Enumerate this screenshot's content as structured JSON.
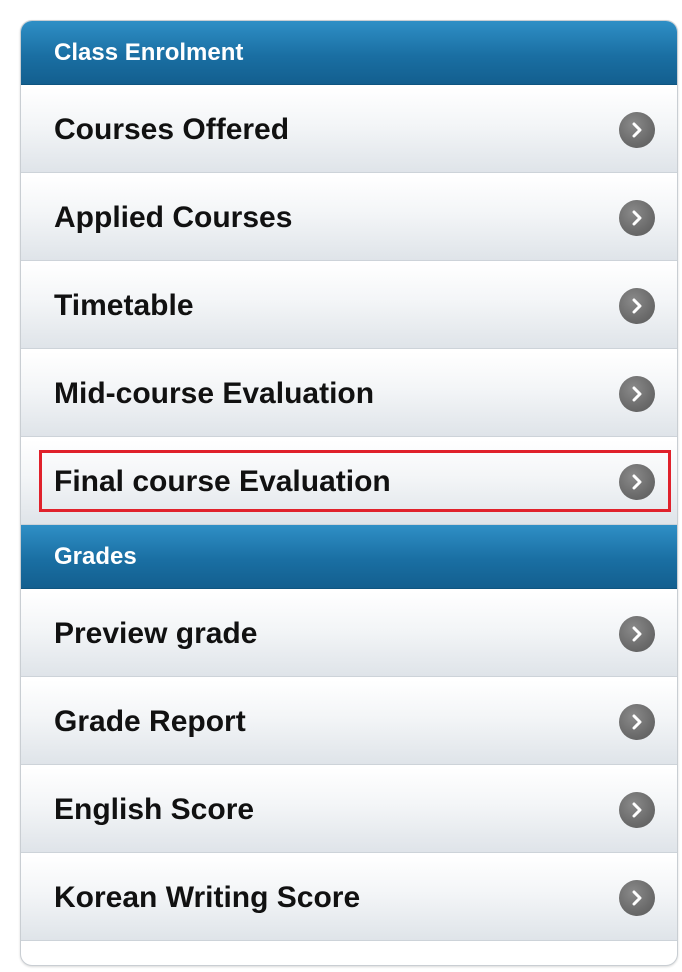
{
  "sections": [
    {
      "title": "Class Enrolment",
      "items": [
        {
          "label": "Courses Offered"
        },
        {
          "label": "Applied Courses"
        },
        {
          "label": "Timetable"
        },
        {
          "label": "Mid-course Evaluation"
        },
        {
          "label": "Final course Evaluation",
          "highlighted": true
        }
      ]
    },
    {
      "title": "Grades",
      "items": [
        {
          "label": "Preview grade"
        },
        {
          "label": "Grade Report"
        },
        {
          "label": "English Score"
        },
        {
          "label": "Korean Writing Score"
        }
      ]
    }
  ],
  "colors": {
    "header_bg": "#1a6fa3",
    "highlight_border": "#e0212b",
    "chevron_circle": "#6b6b6b"
  },
  "icons": {
    "item_arrow": "chevron-right-circle-icon"
  }
}
